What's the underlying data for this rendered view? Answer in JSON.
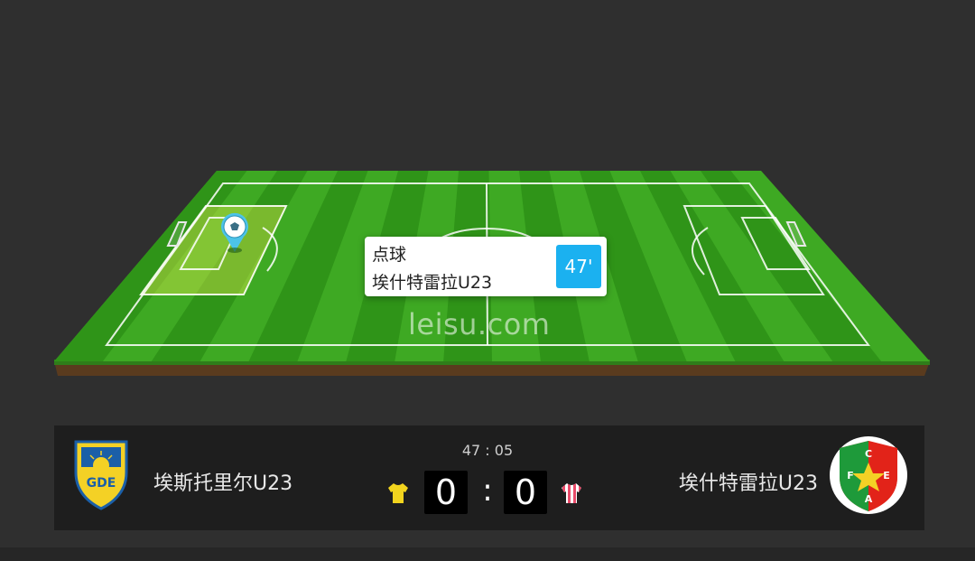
{
  "event": {
    "type": "点球",
    "team": "埃什特雷拉U23",
    "minute": "47'"
  },
  "watermark": "leisu.com",
  "match": {
    "clock": "47 : 05",
    "home": {
      "name": "埃斯托里尔U23",
      "score": "0",
      "kit_color": "#f2d41e"
    },
    "away": {
      "name": "埃什特雷拉U23",
      "score": "0",
      "kit_color": "#e94b6a"
    },
    "separator": ":"
  },
  "away_crest": {
    "letters": [
      "C",
      "F",
      "E",
      "A"
    ]
  },
  "colors": {
    "pitch_light": "#3ea923",
    "pitch_dark": "#2f9418",
    "highlight_zone": "#d7e64a",
    "accent_blue": "#1bb1f0"
  },
  "icons": {
    "event_marker": "football-pin-icon",
    "home_kit": "jersey-icon",
    "away_kit": "striped-jersey-icon"
  }
}
